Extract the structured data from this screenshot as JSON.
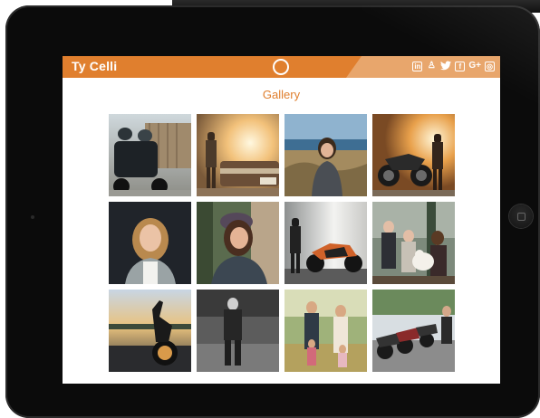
{
  "site": {
    "title": "Ty Celli",
    "menu_icon": "circle-menu-icon",
    "social_icons": [
      {
        "name": "linkedin-icon",
        "glyph": "in"
      },
      {
        "name": "snapchat-icon",
        "glyph": "♙"
      },
      {
        "name": "twitter-icon",
        "glyph": "🐦"
      },
      {
        "name": "facebook-icon",
        "glyph": "f"
      },
      {
        "name": "google-plus-icon",
        "glyph": "G+"
      },
      {
        "name": "instagram-icon",
        "glyph": "◎"
      }
    ],
    "accent_color": "#e07f2e"
  },
  "gallery": {
    "heading": "Gallery",
    "photos": [
      "Two riders in helmets on a motorcycle near a fence",
      "Person standing by a vintage car at sunset",
      "Woman sitting outdoors by a lake",
      "Motorcycle with rider standing in sunlight",
      "Smiling woman with long hair portrait",
      "Woman in beanie portrait outdoors",
      "Person next to an orange sport motorcycle",
      "Family with a white dog on a porch",
      "Motorcycle parked at dusk",
      "Man walking in black and white",
      "Mother with two children in a field",
      "Row of parked motorcycles on a street"
    ]
  }
}
